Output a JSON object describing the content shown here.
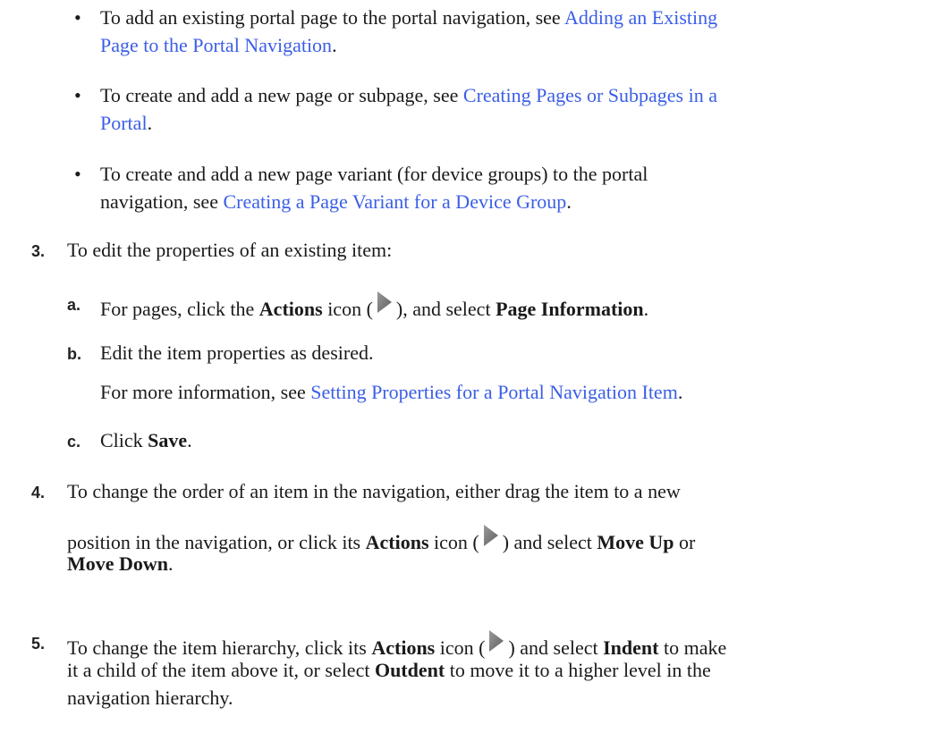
{
  "bullets": [
    {
      "pre": "To add an existing portal page to the portal navigation, see ",
      "link_line1": "Adding an Existing",
      "link_line2": "Page to the Portal Navigation",
      "post": "."
    },
    {
      "pre": "To create and add a new page or subpage, see ",
      "link_line1": "Creating Pages or Subpages in a",
      "link_line2": "Portal",
      "post": "."
    },
    {
      "pre_line1": "To create and add a new page variant (for device groups) to the portal",
      "pre_line2": "navigation, see ",
      "link": "Creating a Page Variant for a Device Group",
      "post": "."
    }
  ],
  "steps": {
    "s3": {
      "num": "3.",
      "text": "To edit the properties of an existing item:",
      "a": {
        "num": "a.",
        "pre": "For pages, click the ",
        "bold1": "Actions",
        "mid1": " icon (",
        "mid2": "), and select ",
        "bold2": "Page Information",
        "post": "."
      },
      "b": {
        "num": "b.",
        "text": "Edit the item properties as desired.",
        "more_pre": "For more information, see ",
        "more_link": "Setting Properties for a Portal Navigation Item",
        "more_post": "."
      },
      "c": {
        "num": "c.",
        "pre": "Click ",
        "bold": "Save",
        "post": "."
      }
    },
    "s4": {
      "num": "4.",
      "line1": "To change the order of an item in the navigation, either drag the item to a new",
      "l2_pre": "position in the navigation, or click its ",
      "l2_bold": "Actions",
      "l2_mid1": " icon (",
      "l2_mid2": ") and select ",
      "l2_bold2": "Move Up",
      "l2_post": " or",
      "l3_bold": "Move Down",
      "l3_post": "."
    },
    "s5": {
      "num": "5.",
      "l1_pre": "To change the item hierarchy, click its ",
      "l1_bold": "Actions",
      "l1_mid1": " icon (",
      "l1_mid2": ") and select ",
      "l1_bold2": "Indent",
      "l1_post": " to make",
      "l2_pre": "it a child of the item above it, or select ",
      "l2_bold": "Outdent",
      "l2_post": " to move it to a higher level in the",
      "line3": "navigation hierarchy."
    }
  },
  "icons": {
    "actions_icon": "actions-arrow-icon",
    "icon_color": "#7a7a7a"
  },
  "colors": {
    "link": "#3b5ee6",
    "text": "#1a1a1a"
  }
}
